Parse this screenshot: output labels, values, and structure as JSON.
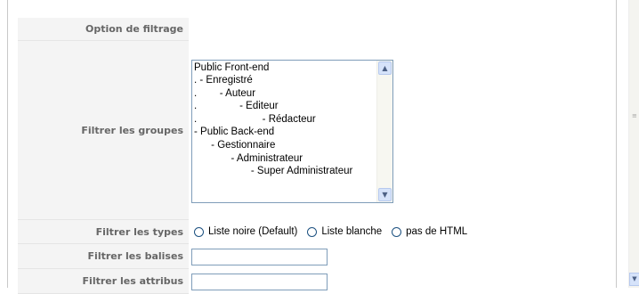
{
  "form": {
    "filter_option_label": "Option de filtrage",
    "filter_groups_label": "Filtrer les groupes",
    "groups_list": [
      "Public Front-end",
      ". - Enregistré",
      ".        - Auteur",
      ".               - Editeur",
      ".                       - Rédacteur",
      "- Public Back-end",
      "      - Gestionnaire",
      "             - Administrateur",
      "                    - Super Administrateur"
    ],
    "filter_types_label": "Filtrer les types",
    "types_options": [
      "Liste noire (Default)",
      "Liste blanche",
      "pas de HTML"
    ],
    "filter_tags_label": "Filtrer les balises",
    "filter_tags_value": "",
    "filter_attributes_label": "Filtrer les attribus",
    "filter_attributes_value": ""
  },
  "icons": {
    "scroll_up": "scroll-up-arrow-icon",
    "scroll_down": "scroll-down-arrow-icon"
  }
}
